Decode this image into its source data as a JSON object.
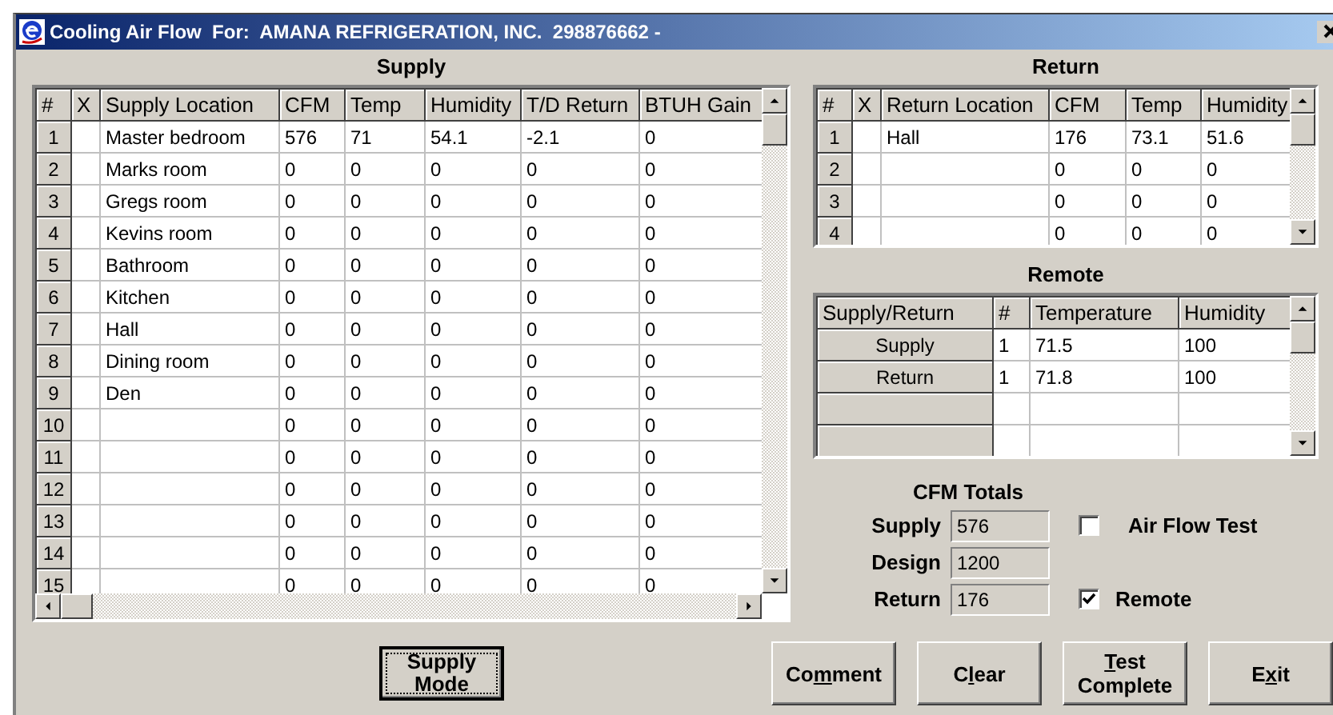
{
  "window": {
    "title": "Cooling Air Flow  For:  AMANA REFRIGERATION, INC.  298876662 -"
  },
  "supply": {
    "heading": "Supply",
    "columns": [
      "#",
      "X",
      "Supply Location",
      "CFM",
      "Temp",
      "Humidity",
      "T/D Return",
      "BTUH Gain"
    ],
    "rows": [
      {
        "number": "1",
        "location": "Master bedroom",
        "cfm": "576",
        "temp": "71",
        "humidity": "54.1",
        "td_return": "-2.1",
        "btuh_gain": "0"
      },
      {
        "number": "2",
        "location": "Marks room",
        "cfm": "0",
        "temp": "0",
        "humidity": "0",
        "td_return": "0",
        "btuh_gain": "0"
      },
      {
        "number": "3",
        "location": "Gregs room",
        "cfm": "0",
        "temp": "0",
        "humidity": "0",
        "td_return": "0",
        "btuh_gain": "0"
      },
      {
        "number": "4",
        "location": "Kevins room",
        "cfm": "0",
        "temp": "0",
        "humidity": "0",
        "td_return": "0",
        "btuh_gain": "0"
      },
      {
        "number": "5",
        "location": "Bathroom",
        "cfm": "0",
        "temp": "0",
        "humidity": "0",
        "td_return": "0",
        "btuh_gain": "0"
      },
      {
        "number": "6",
        "location": "Kitchen",
        "cfm": "0",
        "temp": "0",
        "humidity": "0",
        "td_return": "0",
        "btuh_gain": "0"
      },
      {
        "number": "7",
        "location": "Hall",
        "cfm": "0",
        "temp": "0",
        "humidity": "0",
        "td_return": "0",
        "btuh_gain": "0"
      },
      {
        "number": "8",
        "location": "Dining room",
        "cfm": "0",
        "temp": "0",
        "humidity": "0",
        "td_return": "0",
        "btuh_gain": "0"
      },
      {
        "number": "9",
        "location": "Den",
        "cfm": "0",
        "temp": "0",
        "humidity": "0",
        "td_return": "0",
        "btuh_gain": "0"
      },
      {
        "number": "10",
        "cfm": "0",
        "temp": "0",
        "humidity": "0",
        "td_return": "0",
        "btuh_gain": "0"
      },
      {
        "number": "11",
        "cfm": "0",
        "temp": "0",
        "humidity": "0",
        "td_return": "0",
        "btuh_gain": "0"
      },
      {
        "number": "12",
        "cfm": "0",
        "temp": "0",
        "humidity": "0",
        "td_return": "0",
        "btuh_gain": "0"
      },
      {
        "number": "13",
        "cfm": "0",
        "temp": "0",
        "humidity": "0",
        "td_return": "0",
        "btuh_gain": "0"
      },
      {
        "number": "14",
        "cfm": "0",
        "temp": "0",
        "humidity": "0",
        "td_return": "0",
        "btuh_gain": "0"
      },
      {
        "number": "15",
        "cfm": "0",
        "temp": "0",
        "humidity": "0",
        "td_return": "0",
        "btuh_gain": "0"
      }
    ]
  },
  "return": {
    "heading": "Return",
    "columns": [
      "#",
      "X",
      "Return Location",
      "CFM",
      "Temp",
      "Humidity"
    ],
    "rows": [
      {
        "number": "1",
        "location": "Hall",
        "cfm": "176",
        "temp": "73.1",
        "humidity": "51.6"
      },
      {
        "number": "2",
        "cfm": "0",
        "temp": "0",
        "humidity": "0"
      },
      {
        "number": "3",
        "cfm": "0",
        "temp": "0",
        "humidity": "0"
      },
      {
        "number": "4",
        "cfm": "0",
        "temp": "0",
        "humidity": "0"
      }
    ]
  },
  "remote": {
    "heading": "Remote",
    "columns": [
      "Supply/Return",
      "#",
      "Temperature",
      "Humidity"
    ],
    "rows": [
      {
        "supply_return": "Supply",
        "number": "1",
        "temperature": "71.5",
        "humidity": "100"
      },
      {
        "supply_return": "Return",
        "number": "1",
        "temperature": "71.8",
        "humidity": "100"
      }
    ]
  },
  "cfm_totals": {
    "heading": "CFM Totals",
    "fields": [
      {
        "label": "Supply",
        "value": "576"
      },
      {
        "label": "Design",
        "value": "1200"
      },
      {
        "label": "Return",
        "value": "176"
      }
    ],
    "checkboxes": [
      {
        "label": "Air Flow Test",
        "checked": false
      },
      {
        "label": "Remote",
        "checked": true
      }
    ]
  },
  "buttons": [
    {
      "label": "Supply Mode",
      "focused": true
    },
    {
      "pre": "Co",
      "key": "m",
      "post": "ment",
      "focused": false
    },
    {
      "pre": "C",
      "key": "l",
      "post": "ear",
      "focused": false
    },
    {
      "key": "T",
      "post": "est Complete",
      "focused": false
    },
    {
      "pre": "E",
      "key": "x",
      "post": "it",
      "focused": false
    }
  ]
}
